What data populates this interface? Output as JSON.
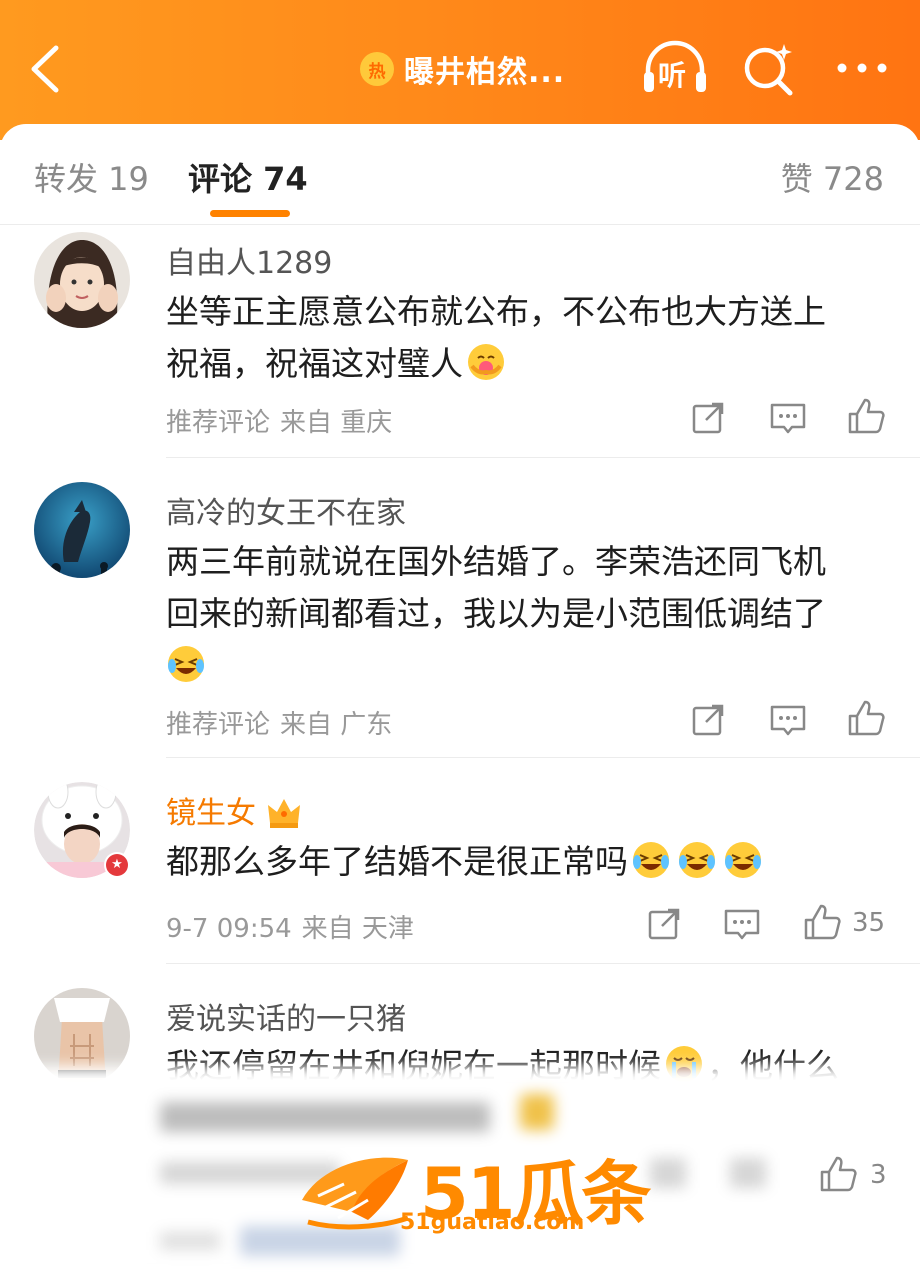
{
  "header": {
    "hot_badge": "热",
    "topic_title": "曝井柏然...",
    "listen_label": "听",
    "back_icon": "chevron-left-icon",
    "search_icon": "search-sparkle-icon",
    "more_icon": "more-dots-icon"
  },
  "tabs": {
    "repost": "转发 19",
    "comment": "评论 74",
    "like": "赞 728"
  },
  "colors": {
    "brand": "#ff8200",
    "vip_name": "#f57a00"
  },
  "comments": [
    {
      "user": "自由人1289",
      "text_line1": "坐等正主愿意公布就公布，不公布也大方送上",
      "text_line2": "祝福，祝福这对璧人",
      "meta_tag": "推荐评论",
      "meta_loc": "来自 重庆",
      "likes": ""
    },
    {
      "user": "高冷的女王不在家",
      "text_line1": "两三年前就说在国外结婚了。李荣浩还同飞机",
      "text_line2": "回来的新闻都看过，我以为是小范围低调结了",
      "meta_tag": "推荐评论",
      "meta_loc": "来自 广东",
      "likes": ""
    },
    {
      "user": "镜生女",
      "text_line1": "都那么多年了结婚不是很正常吗",
      "meta_tag": "9-7 09:54",
      "meta_loc": "来自 天津",
      "likes": "35"
    },
    {
      "user": "爱说实话的一只猪",
      "text_line1": "我还停留在井和倪妮在一起那时候",
      "text_line1_tail": "，他什么",
      "likes": "3"
    }
  ],
  "watermark": {
    "brand": "51瓜条",
    "url": "51guatiao.com"
  }
}
